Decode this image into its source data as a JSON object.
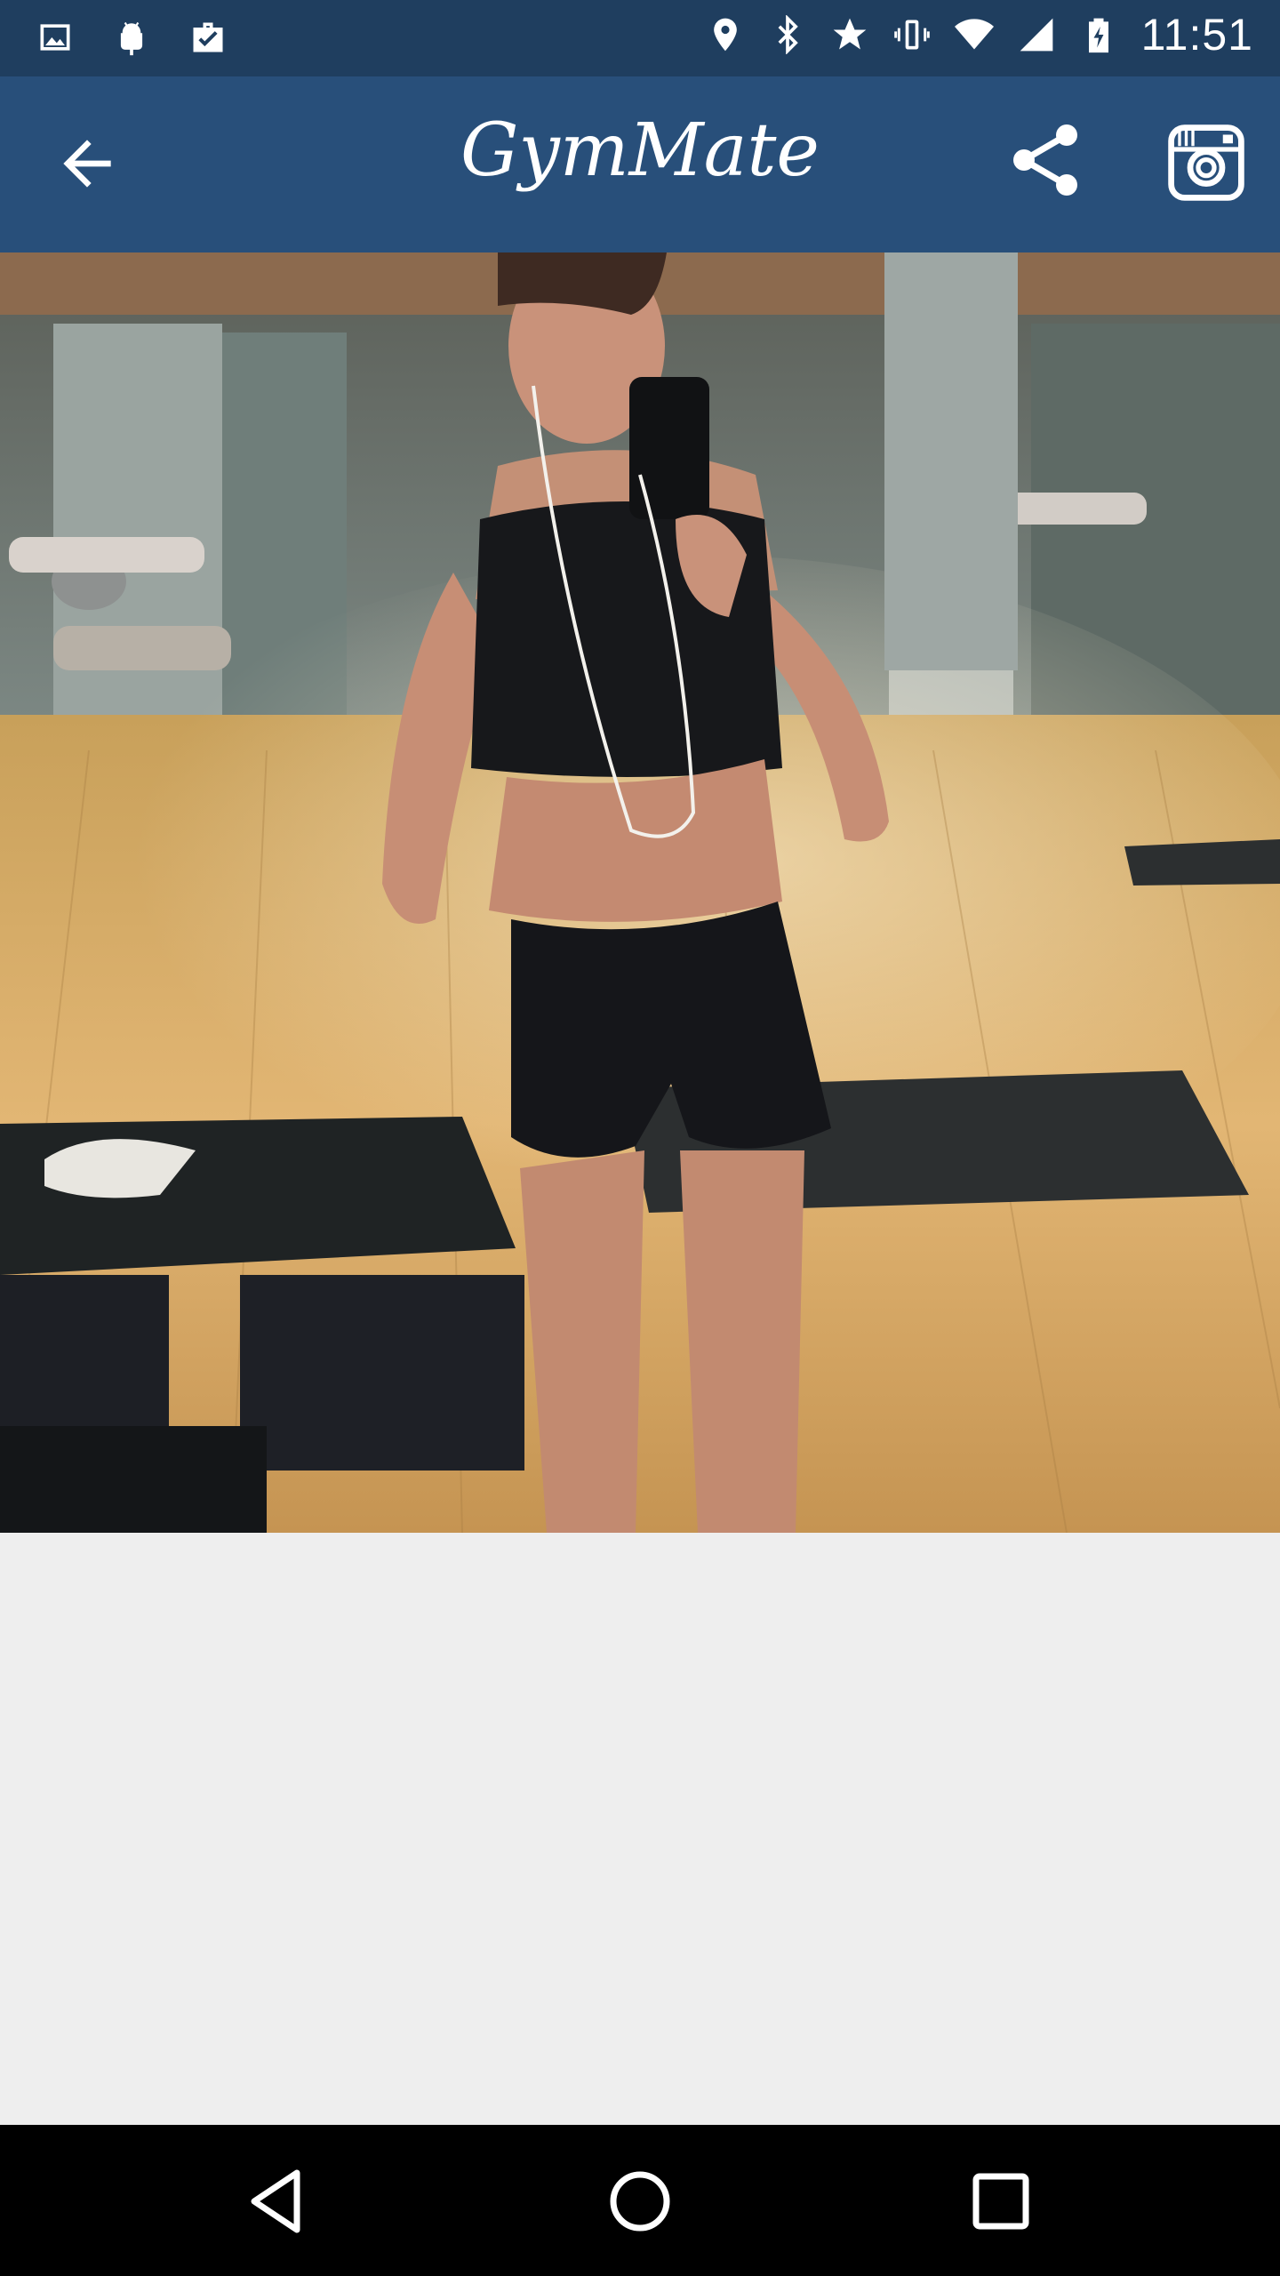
{
  "status_bar": {
    "time": "11:51",
    "left_icons": [
      "gallery-icon",
      "android-icon",
      "briefcase-check-icon"
    ],
    "right_icons": [
      "location-icon",
      "bluetooth-icon",
      "star-icon",
      "vibrate-icon",
      "wifi-icon",
      "signal-icon",
      "battery-charging-icon"
    ]
  },
  "app_bar": {
    "title": "GymMate",
    "back_icon": "arrow-back-icon",
    "share_icon": "share-icon",
    "instagram_icon": "instagram-icon"
  },
  "photo": {
    "icon": "gym-mirror-selfie-photo"
  },
  "nav_bar": {
    "back_icon": "nav-back-icon",
    "home_icon": "nav-home-icon",
    "recents_icon": "nav-recents-icon"
  },
  "colors": {
    "status_bar": "#1f3e5f",
    "app_bar": "#284f7a",
    "content_bg": "#eeeeee",
    "nav_bar": "#000000"
  }
}
